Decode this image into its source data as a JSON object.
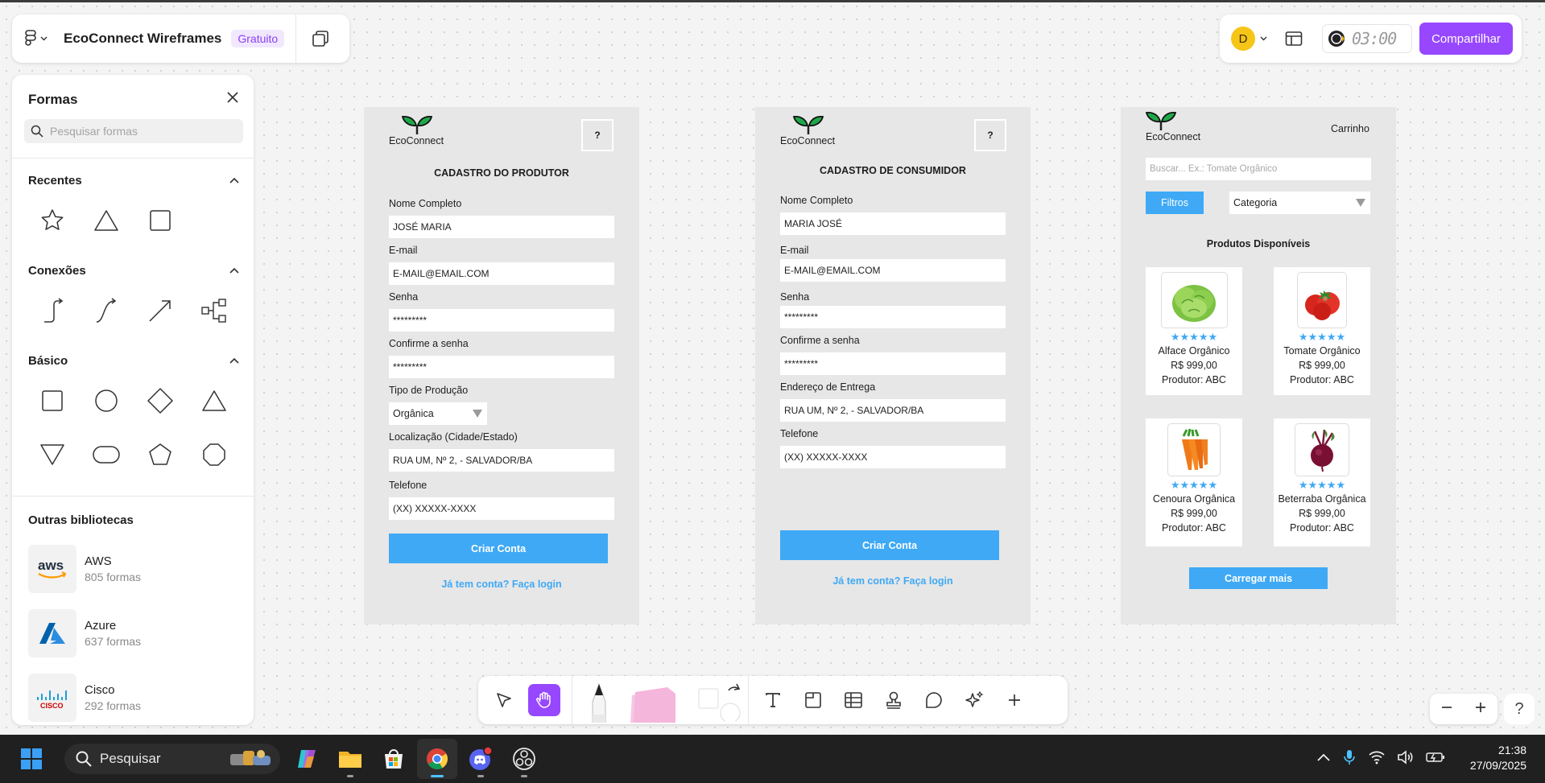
{
  "header": {
    "file_title": "EcoConnect Wireframes",
    "plan_badge": "Gratuito",
    "avatar_initial": "D",
    "timer": "03:00",
    "share_label": "Compartilhar"
  },
  "shapes_panel": {
    "title": "Formas",
    "search_placeholder": "Pesquisar formas",
    "sections": {
      "recent": "Recentes",
      "connections": "Conexões",
      "basic": "Básico",
      "other_libraries": "Outras bibliotecas"
    },
    "libraries": [
      {
        "name": "AWS",
        "count": "805 formas"
      },
      {
        "name": "Azure",
        "count": "637 formas"
      },
      {
        "name": "Cisco",
        "count": "292 formas"
      }
    ]
  },
  "frame_producer": {
    "brand": "EcoConnect",
    "help": "?",
    "title": "CADASTRO DO PRODUTOR",
    "fields": [
      {
        "label": "Nome Completo",
        "value": "JOSÉ MARIA"
      },
      {
        "label": "E-mail",
        "value": "E-MAIL@EMAIL.COM"
      },
      {
        "label": "Senha",
        "value": "*********"
      },
      {
        "label": "Confirme a senha",
        "value": "*********"
      },
      {
        "label": "Tipo de Produção",
        "value": "Orgânica"
      },
      {
        "label": "Localização (Cidade/Estado)",
        "value": "RUA UM, Nº 2, - SALVADOR/BA"
      },
      {
        "label": "Telefone",
        "value": "(XX) XXXXX-XXXX"
      }
    ],
    "button": "Criar Conta",
    "link": "Já tem conta? Faça login"
  },
  "frame_consumer": {
    "brand": "EcoConnect",
    "help": "?",
    "title": "CADASTRO DE CONSUMIDOR",
    "fields": [
      {
        "label": "Nome Completo",
        "value": "MARIA JOSÉ"
      },
      {
        "label": "E-mail",
        "value": "E-MAIL@EMAIL.COM"
      },
      {
        "label": "Senha",
        "value": "*********"
      },
      {
        "label": "Confirme a senha",
        "value": "*********"
      },
      {
        "label": "Endereço de Entrega",
        "value": "RUA UM, Nº 2, - SALVADOR/BA"
      },
      {
        "label": "Telefone",
        "value": "(XX) XXXXX-XXXX"
      }
    ],
    "button": "Criar Conta",
    "link": "Já tem conta? Faça login"
  },
  "frame_market": {
    "brand": "EcoConnect",
    "cart": "Carrinho",
    "search_placeholder": "Buscar... Ex.: Tomate Orgânico",
    "filters": "Filtros",
    "category": "Categoria",
    "section_title": "Produtos Disponíveis",
    "stars": "★★★★★",
    "products": [
      {
        "name": "Alface Orgânico",
        "price": "R$ 999,00",
        "producer": "Produtor: ABC"
      },
      {
        "name": "Tomate Orgânico",
        "price": "R$ 999,00",
        "producer": "Produtor: ABC"
      },
      {
        "name": "Cenoura Orgânica",
        "price": "R$ 999,00",
        "producer": "Produtor: ABC"
      },
      {
        "name": "Beterraba Orgânica",
        "price": "R$ 999,00",
        "producer": "Produtor: ABC"
      }
    ],
    "load_more": "Carregar mais"
  },
  "taskbar": {
    "search_label": "Pesquisar",
    "time": "21:38",
    "date": "27/09/2025"
  },
  "colors": {
    "accent_purple": "#9747ff",
    "wireframe_blue": "#3fa9f5",
    "frame_bg": "#e7e7e7"
  }
}
